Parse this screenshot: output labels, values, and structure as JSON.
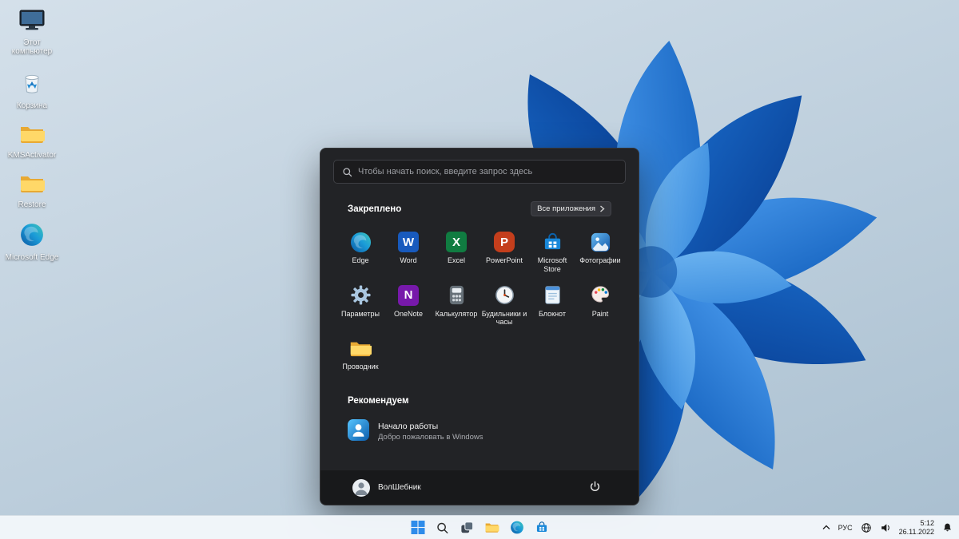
{
  "desktop": {
    "icons": [
      {
        "label": "Этот компьютер"
      },
      {
        "label": "Корзина"
      },
      {
        "label": "KMSActivator"
      },
      {
        "label": "Restore"
      },
      {
        "label": "Microsoft Edge"
      }
    ]
  },
  "start_menu": {
    "search_placeholder": "Чтобы начать поиск, введите запрос здесь",
    "pinned_header": "Закреплено",
    "all_apps_label": "Все приложения",
    "pinned_apps": [
      {
        "label": "Edge"
      },
      {
        "label": "Word"
      },
      {
        "label": "Excel"
      },
      {
        "label": "PowerPoint"
      },
      {
        "label": "Microsoft Store"
      },
      {
        "label": "Фотографии"
      },
      {
        "label": "Параметры"
      },
      {
        "label": "OneNote"
      },
      {
        "label": "Калькулятор"
      },
      {
        "label": "Будильники и часы"
      },
      {
        "label": "Блокнот"
      },
      {
        "label": "Paint"
      },
      {
        "label": "Проводник"
      }
    ],
    "recommended_header": "Рекомендуем",
    "recommended_item": {
      "title": "Начало работы",
      "subtitle": "Добро пожаловать в Windows"
    },
    "user_name": "ВолШебник"
  },
  "taskbar": {
    "language": "РУС",
    "time": "5:12",
    "date": "26.11.2022"
  },
  "colors": {
    "accent": "#0b6ac9",
    "menu_bg": "#222326",
    "taskbar_bg": "#f2f6fa"
  }
}
